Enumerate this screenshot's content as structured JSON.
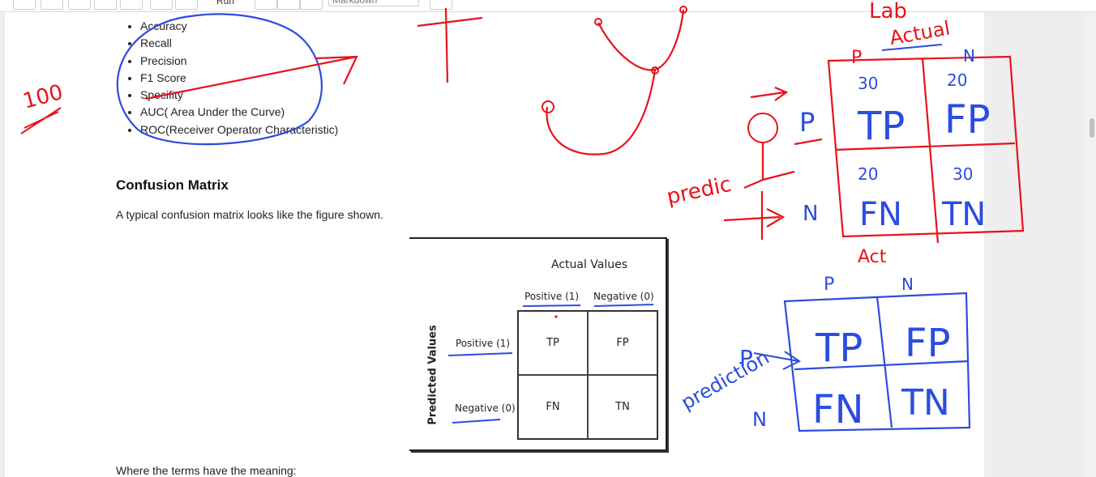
{
  "toolbar": {
    "run_label": "Run",
    "cell_type": "Markdown"
  },
  "notebook": {
    "metrics": [
      "Accuracy",
      "Recall",
      "Precision",
      "F1 Score",
      "Specifity",
      "AUC( Area Under the Curve)",
      "ROC(Receiver Operator Characteristic)"
    ],
    "section_title": "Confusion Matrix",
    "description": "A typical confusion matrix looks like the figure shown.",
    "footer_text": "Where the terms have the meaning:"
  },
  "figure": {
    "title": "Actual Values",
    "col_positive": "Positive (1)",
    "col_negative": "Negative (0)",
    "row_axis": "Predicted Values",
    "row_positive": "Positive (1)",
    "row_negative": "Negative (0)",
    "cells": [
      "TP",
      "FP",
      "FN",
      "TN"
    ]
  },
  "annotations": {
    "red": {
      "count": "100",
      "lab": "Lab",
      "actual": "Actual",
      "predict": "predic",
      "col_p": "P",
      "col_n": "N",
      "row_p": "P",
      "row_n": "N",
      "n_tp": "30",
      "n_fp": "20",
      "n_fn": "20",
      "n_tn": "30",
      "tp": "TP",
      "fp": "FP",
      "fn": "FN",
      "tn": "TN",
      "act": "Act"
    },
    "blue": {
      "predict": "prediction",
      "col_p": "P",
      "col_n": "N",
      "row_p": "P",
      "row_n": "N",
      "tp": "TP",
      "fp": "FP",
      "fn": "FN",
      "tn": "TN"
    }
  },
  "colors": {
    "ink_red": "#e8121b",
    "ink_blue": "#2b4ce0",
    "page_bg": "#ffffff",
    "chrome_bg": "#eeeeee"
  }
}
